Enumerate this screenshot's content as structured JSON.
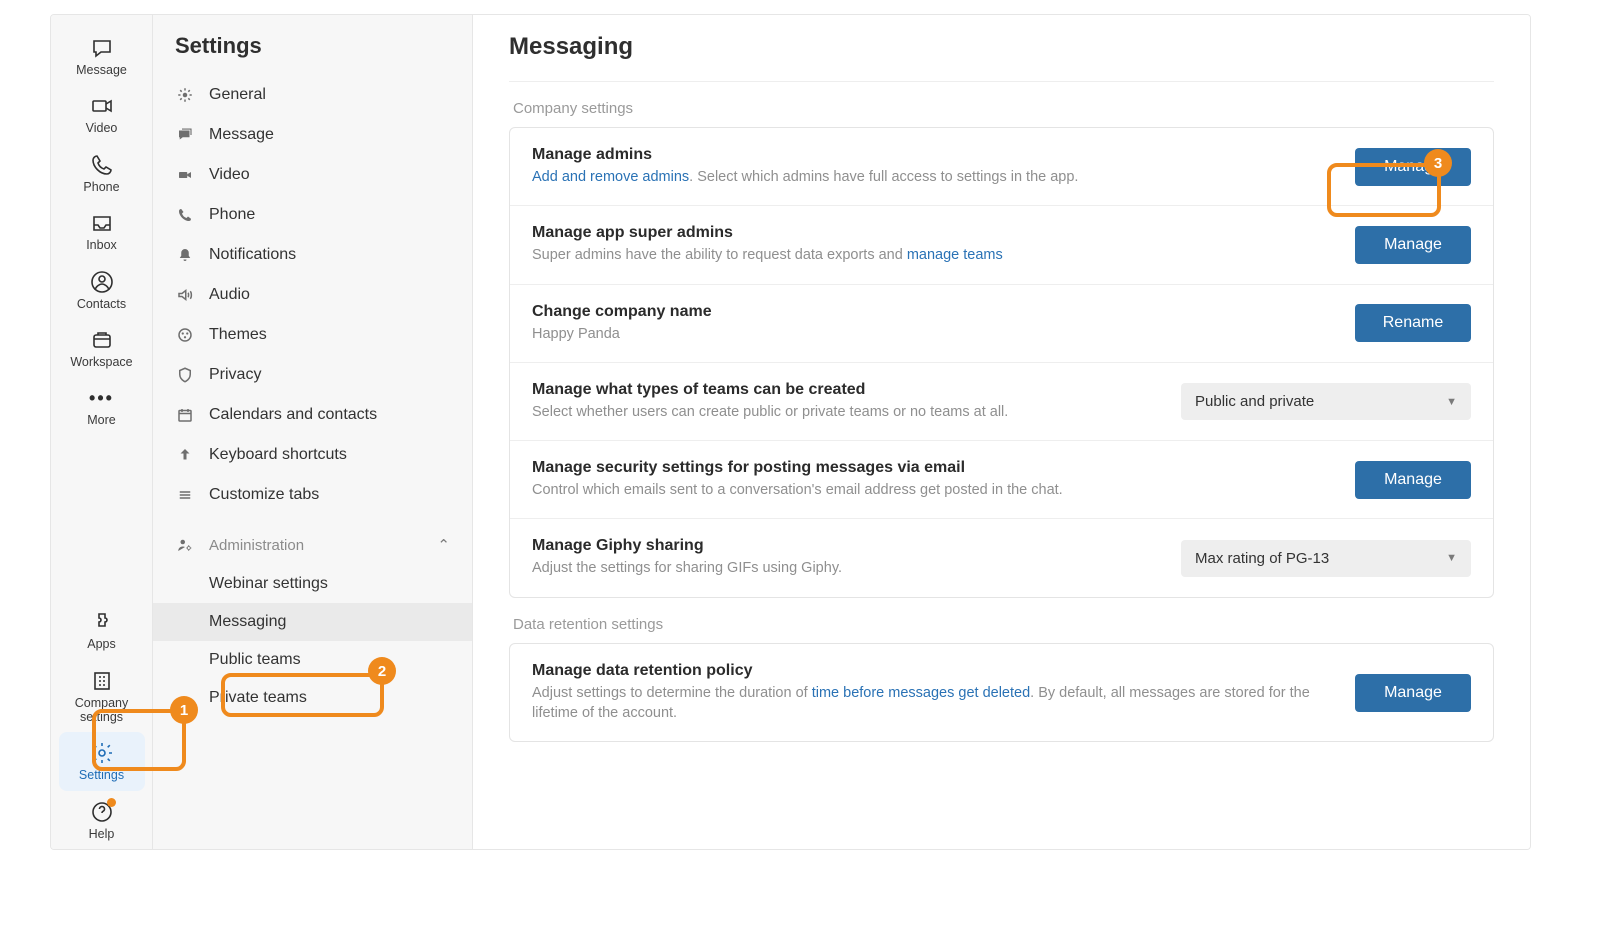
{
  "rail": {
    "top": [
      {
        "id": "message",
        "label": "Message"
      },
      {
        "id": "video",
        "label": "Video"
      },
      {
        "id": "phone",
        "label": "Phone"
      },
      {
        "id": "inbox",
        "label": "Inbox"
      },
      {
        "id": "contacts",
        "label": "Contacts"
      },
      {
        "id": "workspace",
        "label": "Workspace"
      },
      {
        "id": "more",
        "label": "More"
      }
    ],
    "bottom": [
      {
        "id": "apps",
        "label": "Apps"
      },
      {
        "id": "company-settings",
        "label": "Company settings"
      },
      {
        "id": "settings",
        "label": "Settings",
        "active": true
      },
      {
        "id": "help",
        "label": "Help"
      }
    ]
  },
  "panel": {
    "title": "Settings",
    "items": [
      {
        "id": "general",
        "label": "General"
      },
      {
        "id": "message",
        "label": "Message"
      },
      {
        "id": "video",
        "label": "Video"
      },
      {
        "id": "phone",
        "label": "Phone"
      },
      {
        "id": "notifications",
        "label": "Notifications"
      },
      {
        "id": "audio",
        "label": "Audio"
      },
      {
        "id": "themes",
        "label": "Themes"
      },
      {
        "id": "privacy",
        "label": "Privacy"
      },
      {
        "id": "calendars",
        "label": "Calendars and contacts"
      },
      {
        "id": "keyboard",
        "label": "Keyboard shortcuts"
      },
      {
        "id": "customize",
        "label": "Customize tabs"
      }
    ],
    "admin": {
      "label": "Administration",
      "items": [
        {
          "id": "webinar",
          "label": "Webinar settings"
        },
        {
          "id": "messaging",
          "label": "Messaging",
          "active": true
        },
        {
          "id": "public-teams",
          "label": "Public teams"
        },
        {
          "id": "private-teams",
          "label": "Private teams"
        }
      ]
    }
  },
  "main": {
    "title": "Messaging",
    "section1": "Company settings",
    "section2": "Data retention settings",
    "rows": [
      {
        "title": "Manage admins",
        "link": "Add and remove admins",
        "after_link": ". Select which admins have full access to settings in the app.",
        "action": "Manage",
        "type": "button"
      },
      {
        "title": "Manage app super admins",
        "pre": "Super admins have the ability to request data exports and ",
        "link": "manage teams",
        "after_link": "",
        "action": "Manage",
        "type": "button"
      },
      {
        "title": "Change company name",
        "desc": "Happy Panda",
        "action": "Rename",
        "type": "button"
      },
      {
        "title": "Manage what types of teams can be created",
        "desc": "Select whether users can create public or private teams or no teams at all.",
        "action": "Public and private",
        "type": "select"
      },
      {
        "title": "Manage security settings for posting messages via email",
        "desc": "Control which emails sent to a conversation's email address get posted in the chat.",
        "action": "Manage",
        "type": "button"
      },
      {
        "title": "Manage Giphy sharing",
        "desc": "Adjust the settings for sharing GIFs using Giphy.",
        "action": "Max rating of PG-13",
        "type": "select"
      }
    ],
    "retention": {
      "title": "Manage data retention policy",
      "pre": "Adjust settings to determine the duration of ",
      "link": "time before messages get deleted",
      "after_link": ". By default, all messages are stored for the lifetime of the account.",
      "action": "Manage"
    }
  },
  "callouts": {
    "1": "1",
    "2": "2",
    "3": "3"
  }
}
